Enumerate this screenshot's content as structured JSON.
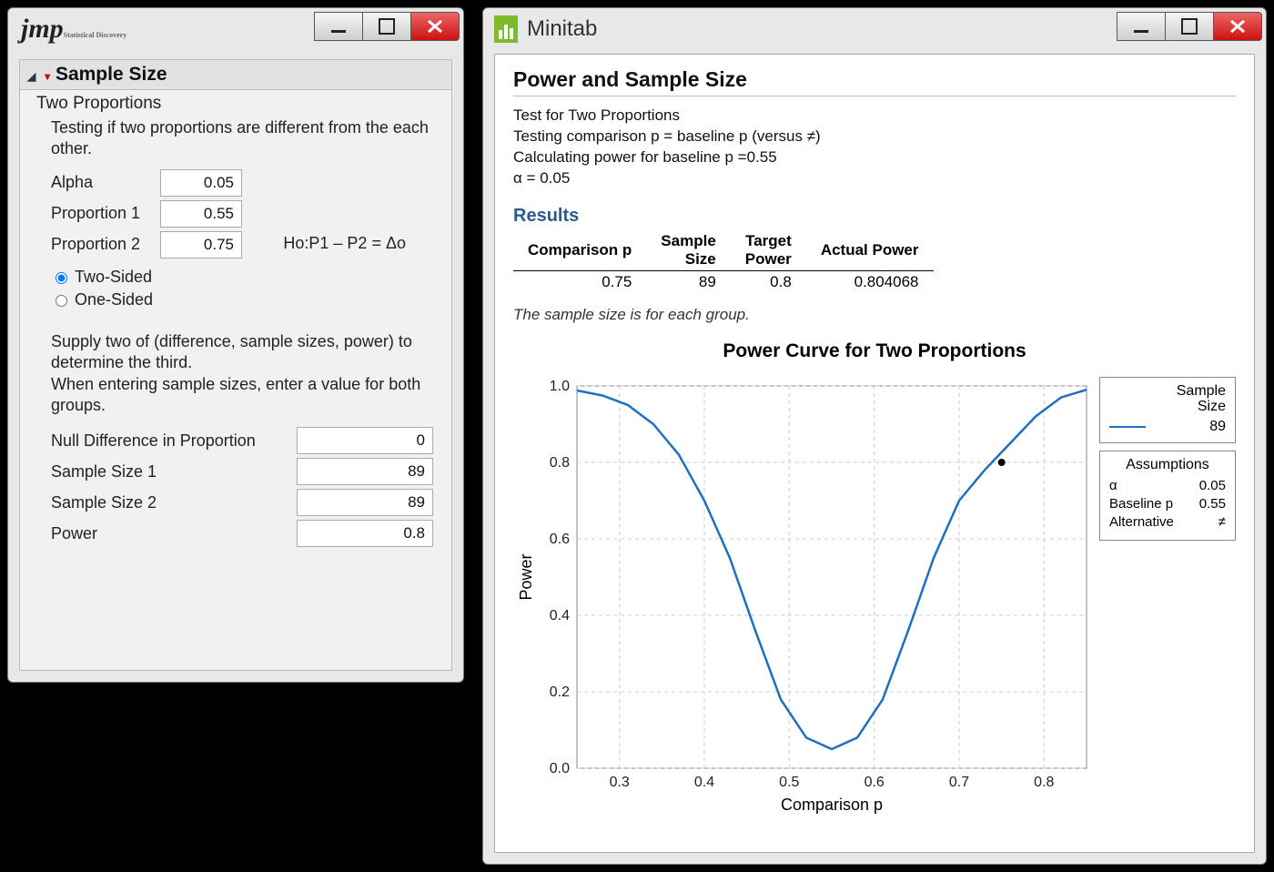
{
  "jmp": {
    "section_title": "Sample Size",
    "fieldset_title": "Two Proportions",
    "description": "Testing if two proportions are different from the each other.",
    "hypothesis": "Ho:P1 – P2 = Δo",
    "alpha_label": "Alpha",
    "alpha_value": "0.05",
    "p1_label": "Proportion 1",
    "p1_value": "0.55",
    "p2_label": "Proportion 2",
    "p2_value": "0.75",
    "radio_two": "Two-Sided",
    "radio_one": "One-Sided",
    "instructions": "Supply two of (difference, sample sizes, power) to determine the third.\nWhen entering sample sizes, enter a value for both groups.",
    "nulldiff_label": "Null Difference in Proportion",
    "nulldiff_value": "0",
    "n1_label": "Sample Size 1",
    "n1_value": "89",
    "n2_label": "Sample Size 2",
    "n2_value": "89",
    "power_label": "Power",
    "power_value": "0.8"
  },
  "minitab": {
    "app_name": "Minitab",
    "title": "Power and Sample Size",
    "meta1": "Test for Two Proportions",
    "meta2": "Testing comparison p = baseline p (versus ≠)",
    "meta3": "Calculating power for baseline p =0.55",
    "meta4": "α = 0.05",
    "results_heading": "Results",
    "table": {
      "h1": "Comparison p",
      "h2": "Sample\nSize",
      "h3": "Target\nPower",
      "h4": "Actual Power",
      "r1c1": "0.75",
      "r1c2": "89",
      "r1c3": "0.8",
      "r1c4": "0.804068"
    },
    "note": "The sample size is for each group.",
    "chart_title": "Power Curve for Two Proportions",
    "legend": {
      "sample_size_label": "Sample\nSize",
      "sample_size_value": "89",
      "assumptions_title": "Assumptions",
      "alpha_k": "α",
      "alpha_v": "0.05",
      "base_k": "Baseline p",
      "base_v": "0.55",
      "alt_k": "Alternative",
      "alt_v": "≠"
    },
    "axes": {
      "xlabel": "Comparison p",
      "ylabel": "Power",
      "xt03": "0.3",
      "xt04": "0.4",
      "xt05": "0.5",
      "xt06": "0.6",
      "xt07": "0.7",
      "xt08": "0.8",
      "yt00": "0.0",
      "yt02": "0.2",
      "yt04": "0.4",
      "yt06": "0.6",
      "yt08": "0.8",
      "yt10": "1.0"
    }
  },
  "chart_data": {
    "type": "line",
    "title": "Power Curve for Two Proportions",
    "xlabel": "Comparison p",
    "ylabel": "Power",
    "xlim": [
      0.25,
      0.85
    ],
    "ylim": [
      0.0,
      1.0
    ],
    "series": [
      {
        "name": "89",
        "x": [
          0.25,
          0.28,
          0.31,
          0.34,
          0.37,
          0.4,
          0.43,
          0.46,
          0.49,
          0.52,
          0.55,
          0.58,
          0.61,
          0.64,
          0.67,
          0.7,
          0.73,
          0.76,
          0.79,
          0.82,
          0.85
        ],
        "y": [
          0.988,
          0.975,
          0.95,
          0.9,
          0.82,
          0.7,
          0.55,
          0.36,
          0.18,
          0.08,
          0.05,
          0.08,
          0.18,
          0.36,
          0.55,
          0.7,
          0.78,
          0.85,
          0.92,
          0.97,
          0.99
        ]
      }
    ],
    "markers": [
      {
        "x": 0.75,
        "y": 0.8
      }
    ],
    "legend_position": "right",
    "grid": true,
    "assumptions": {
      "alpha": 0.05,
      "baseline_p": 0.55,
      "alternative": "≠",
      "sample_size": 89
    }
  }
}
